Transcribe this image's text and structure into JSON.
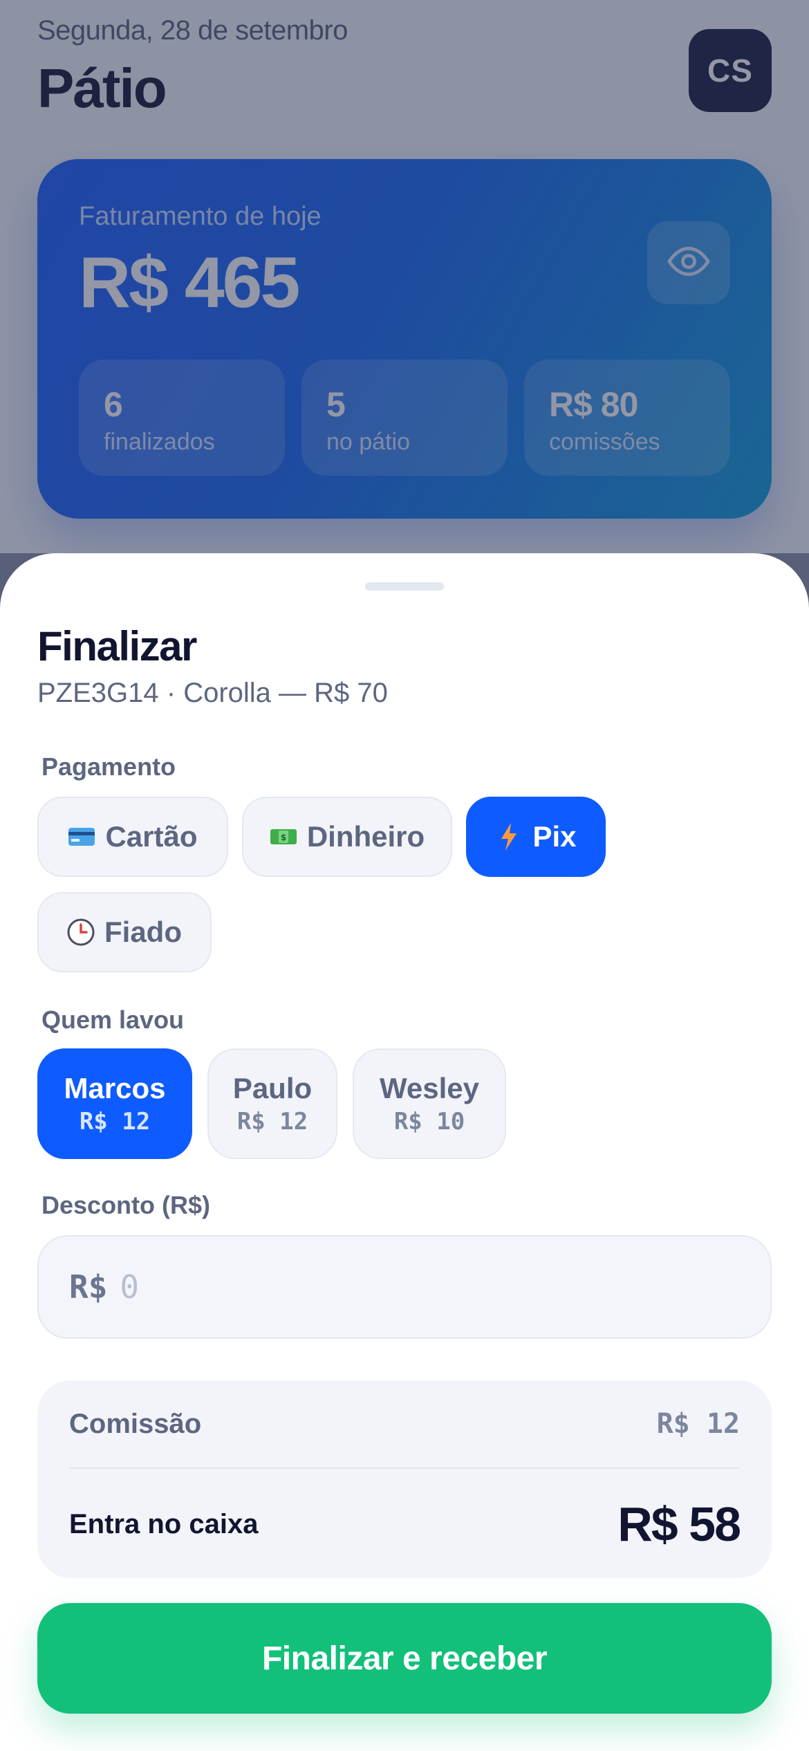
{
  "header": {
    "date": "Segunda, 28 de setembro",
    "title": "Pátio",
    "avatar_initials": "CS"
  },
  "revenue_card": {
    "label": "Faturamento de hoje",
    "value": "R$ 465",
    "eye_icon": "eye-icon",
    "stats": [
      {
        "value": "6",
        "label": "finalizados"
      },
      {
        "value": "5",
        "label": "no pátio"
      },
      {
        "value": "R$ 80",
        "label": "comissões"
      }
    ],
    "gradient_colors": [
      "#1a5cff",
      "#0d9bd9"
    ]
  },
  "sheet": {
    "title": "Finalizar",
    "subtitle": "PZE3G14 · Corolla — R$ 70",
    "payment": {
      "label": "Pagamento",
      "options": [
        {
          "label": "Cartão",
          "icon": "credit-card-icon",
          "selected": false
        },
        {
          "label": "Dinheiro",
          "icon": "cash-icon",
          "selected": false
        },
        {
          "label": "Pix",
          "icon": "lightning-icon",
          "selected": true
        },
        {
          "label": "Fiado",
          "icon": "clock-icon",
          "selected": false
        }
      ]
    },
    "washers": {
      "label": "Quem lavou",
      "options": [
        {
          "name": "Marcos",
          "amount": "R$ 12",
          "selected": true
        },
        {
          "name": "Paulo",
          "amount": "R$ 12",
          "selected": false
        },
        {
          "name": "Wesley",
          "amount": "R$ 10",
          "selected": false
        }
      ]
    },
    "discount": {
      "label": "Desconto (R$)",
      "prefix": "R$",
      "placeholder": "0",
      "value": ""
    },
    "summary": {
      "commission_label": "Comissão",
      "commission_value": "R$ 12",
      "net_label": "Entra no caixa",
      "net_value": "R$ 58"
    },
    "cta_label": "Finalizar e receber"
  },
  "colors": {
    "accent": "#0e5cff",
    "success": "#12c07a",
    "text_dark": "#121530",
    "text_muted": "#5d6680"
  }
}
